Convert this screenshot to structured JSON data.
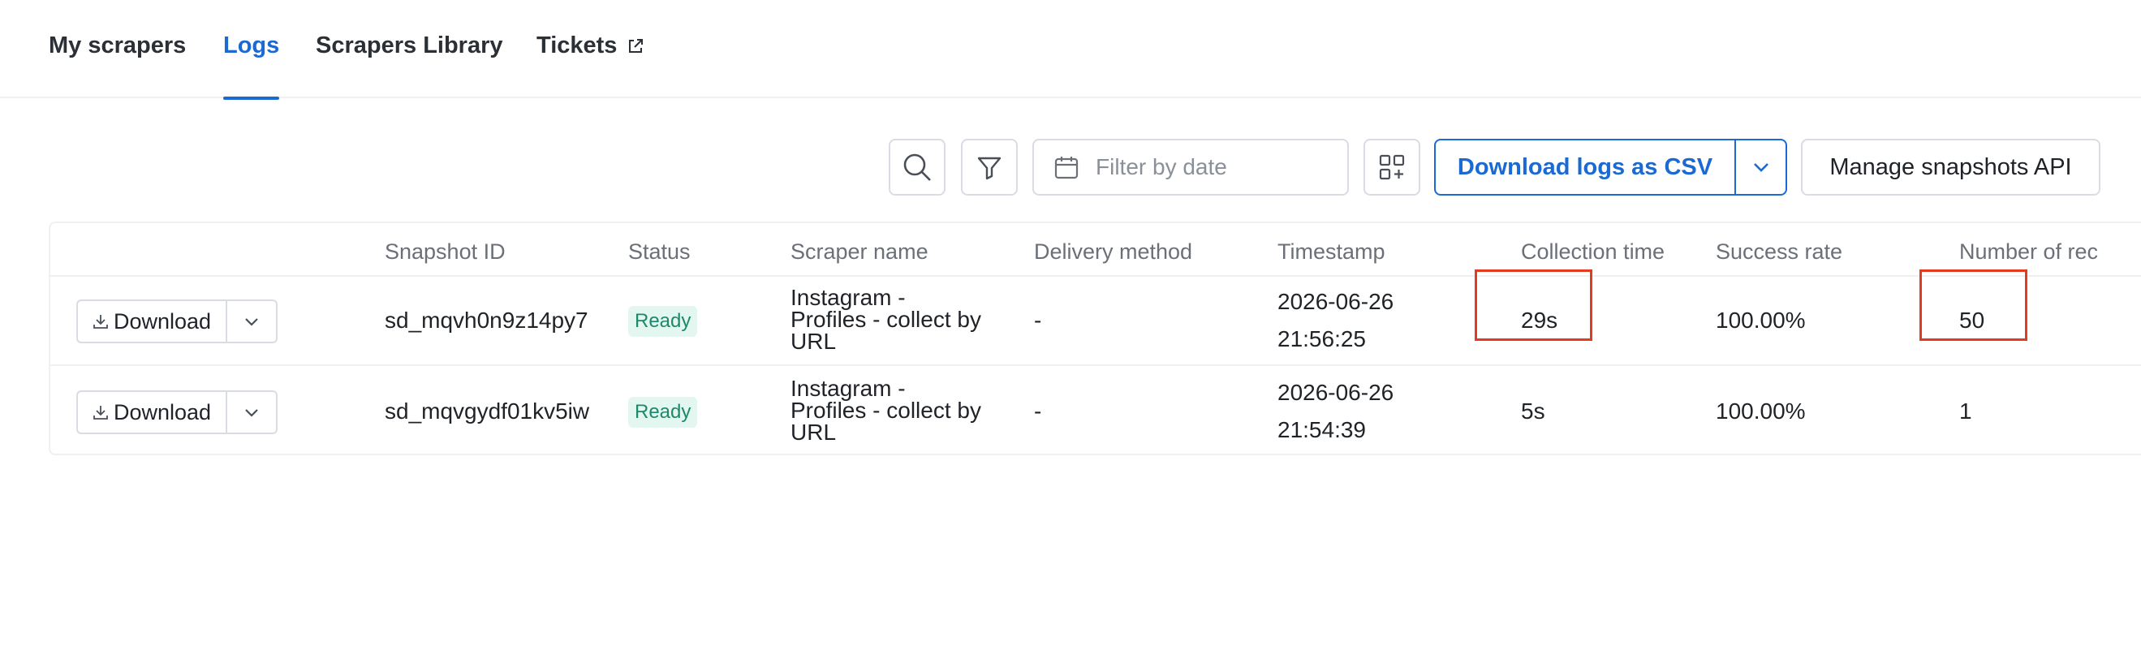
{
  "tabs": [
    {
      "label": "My scrapers",
      "active": false
    },
    {
      "label": "Logs",
      "active": true
    },
    {
      "label": "Scrapers Library",
      "active": false
    },
    {
      "label": "Tickets",
      "active": false,
      "external": true
    }
  ],
  "toolbar": {
    "date_filter_placeholder": "Filter by date",
    "download_csv_label": "Download logs as CSV",
    "manage_api_label": "Manage snapshots API"
  },
  "table": {
    "columns": [
      "Snapshot ID",
      "Status",
      "Scraper name",
      "Delivery method",
      "Timestamp",
      "Collection time",
      "Success rate",
      "Number of rec"
    ],
    "rows": [
      {
        "download_label": "Download",
        "snapshot_id": "sd_mqvh0n9z14py7",
        "status": "Ready",
        "scraper_name": "Instagram - Profiles - collect by URL",
        "delivery_method": "-",
        "timestamp_date": "2026-06-26",
        "timestamp_time": "21:56:25",
        "collection_time": "29s",
        "success_rate": "100.00%",
        "records": "50"
      },
      {
        "download_label": "Download",
        "snapshot_id": "sd_mqvgydf01kv5iw",
        "status": "Ready",
        "scraper_name": "Instagram - Profiles - collect by URL",
        "delivery_method": "-",
        "timestamp_date": "2026-06-26",
        "timestamp_time": "21:54:39",
        "collection_time": "5s",
        "success_rate": "100.00%",
        "records": "1"
      }
    ]
  },
  "colors": {
    "accent": "#1b6ad4",
    "status_ready_bg": "#e3f6f0",
    "status_ready_text": "#1c8a6a",
    "highlight": "#e23b1f"
  },
  "icons": {
    "search": "search-icon",
    "filter": "filter-icon",
    "calendar": "calendar-icon",
    "columns": "columns-add-icon",
    "chevron": "chevron-down-icon",
    "download": "download-icon",
    "external": "external-link-icon"
  }
}
